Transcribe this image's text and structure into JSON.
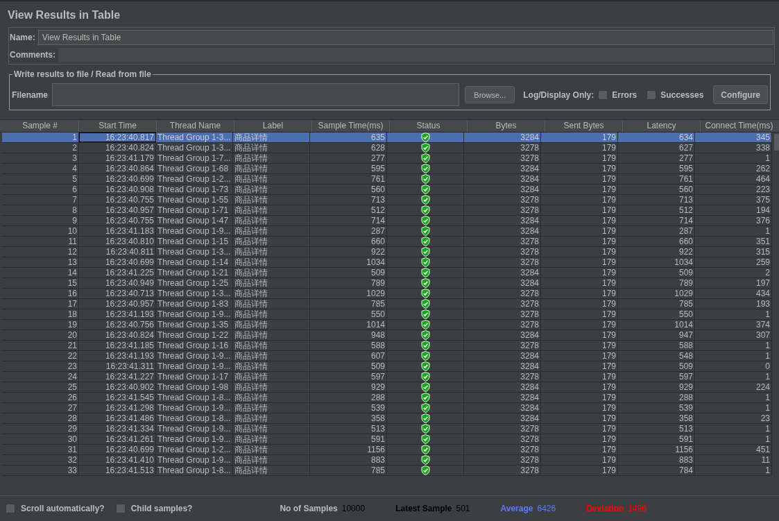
{
  "title": "View Results in Table",
  "name_field": {
    "label": "Name:",
    "value": "View Results in Table"
  },
  "comments_field": {
    "label": "Comments:"
  },
  "file_panel": {
    "legend": "Write results to file / Read from file",
    "filename_label": "Filename",
    "browse_button": "Browse...",
    "log_label": "Log/Display Only:",
    "checkboxes": [
      {
        "label": "Errors",
        "checked": false
      },
      {
        "label": "Successes",
        "checked": false
      }
    ],
    "configure_button": "Configure"
  },
  "table": {
    "columns": [
      "Sample #",
      "Start Time",
      "Thread Name",
      "Label",
      "Sample Time(ms)",
      "Status",
      "Bytes",
      "Sent Bytes",
      "Latency",
      "Connect Time(ms)"
    ],
    "rows": [
      {
        "n": "1",
        "start": "16:23:40.817",
        "thread": "Thread Group 1-3...",
        "label": "商品详情",
        "time": "635",
        "success": true,
        "bytes": "3284",
        "sent": "179",
        "latency": "634",
        "connect": "345",
        "selected": true
      },
      {
        "n": "2",
        "start": "16:23:40.824",
        "thread": "Thread Group 1-3...",
        "label": "商品详情",
        "time": "628",
        "success": true,
        "bytes": "3278",
        "sent": "179",
        "latency": "627",
        "connect": "338",
        "selected": false
      },
      {
        "n": "3",
        "start": "16:23:41.179",
        "thread": "Thread Group 1-7...",
        "label": "商品详情",
        "time": "277",
        "success": true,
        "bytes": "3278",
        "sent": "179",
        "latency": "277",
        "connect": "1",
        "selected": false
      },
      {
        "n": "4",
        "start": "16:23:40.864",
        "thread": "Thread Group 1-68",
        "label": "商品详情",
        "time": "595",
        "success": true,
        "bytes": "3284",
        "sent": "179",
        "latency": "595",
        "connect": "262",
        "selected": false
      },
      {
        "n": "5",
        "start": "16:23:40.699",
        "thread": "Thread Group 1-2...",
        "label": "商品详情",
        "time": "761",
        "success": true,
        "bytes": "3284",
        "sent": "179",
        "latency": "761",
        "connect": "464",
        "selected": false
      },
      {
        "n": "6",
        "start": "16:23:40.908",
        "thread": "Thread Group 1-73",
        "label": "商品详情",
        "time": "560",
        "success": true,
        "bytes": "3284",
        "sent": "179",
        "latency": "560",
        "connect": "223",
        "selected": false
      },
      {
        "n": "7",
        "start": "16:23:40.755",
        "thread": "Thread Group 1-55",
        "label": "商品详情",
        "time": "713",
        "success": true,
        "bytes": "3278",
        "sent": "179",
        "latency": "713",
        "connect": "375",
        "selected": false
      },
      {
        "n": "8",
        "start": "16:23:40.957",
        "thread": "Thread Group 1-71",
        "label": "商品详情",
        "time": "512",
        "success": true,
        "bytes": "3278",
        "sent": "179",
        "latency": "512",
        "connect": "194",
        "selected": false
      },
      {
        "n": "9",
        "start": "16:23:40.755",
        "thread": "Thread Group 1-47",
        "label": "商品详情",
        "time": "714",
        "success": true,
        "bytes": "3284",
        "sent": "179",
        "latency": "714",
        "connect": "376",
        "selected": false
      },
      {
        "n": "10",
        "start": "16:23:41.183",
        "thread": "Thread Group 1-9...",
        "label": "商品详情",
        "time": "287",
        "success": true,
        "bytes": "3284",
        "sent": "179",
        "latency": "287",
        "connect": "1",
        "selected": false
      },
      {
        "n": "11",
        "start": "16:23:40.810",
        "thread": "Thread Group 1-15",
        "label": "商品详情",
        "time": "660",
        "success": true,
        "bytes": "3278",
        "sent": "179",
        "latency": "660",
        "connect": "351",
        "selected": false
      },
      {
        "n": "12",
        "start": "16:23:40.811",
        "thread": "Thread Group 1-3...",
        "label": "商品详情",
        "time": "922",
        "success": true,
        "bytes": "3278",
        "sent": "179",
        "latency": "922",
        "connect": "315",
        "selected": false
      },
      {
        "n": "13",
        "start": "16:23:40.699",
        "thread": "Thread Group 1-14",
        "label": "商品详情",
        "time": "1034",
        "success": true,
        "bytes": "3278",
        "sent": "179",
        "latency": "1034",
        "connect": "259",
        "selected": false
      },
      {
        "n": "14",
        "start": "16:23:41.225",
        "thread": "Thread Group 1-21",
        "label": "商品详情",
        "time": "509",
        "success": true,
        "bytes": "3284",
        "sent": "179",
        "latency": "509",
        "connect": "2",
        "selected": false
      },
      {
        "n": "15",
        "start": "16:23:40.949",
        "thread": "Thread Group 1-25",
        "label": "商品详情",
        "time": "789",
        "success": true,
        "bytes": "3284",
        "sent": "179",
        "latency": "789",
        "connect": "197",
        "selected": false
      },
      {
        "n": "16",
        "start": "16:23:40.713",
        "thread": "Thread Group 1-3...",
        "label": "商品详情",
        "time": "1029",
        "success": true,
        "bytes": "3278",
        "sent": "179",
        "latency": "1029",
        "connect": "434",
        "selected": false
      },
      {
        "n": "17",
        "start": "16:23:40.957",
        "thread": "Thread Group 1-83",
        "label": "商品详情",
        "time": "785",
        "success": true,
        "bytes": "3278",
        "sent": "179",
        "latency": "785",
        "connect": "193",
        "selected": false
      },
      {
        "n": "18",
        "start": "16:23:41.193",
        "thread": "Thread Group 1-9...",
        "label": "商品详情",
        "time": "550",
        "success": true,
        "bytes": "3278",
        "sent": "179",
        "latency": "550",
        "connect": "1",
        "selected": false
      },
      {
        "n": "19",
        "start": "16:23:40.756",
        "thread": "Thread Group 1-35",
        "label": "商品详情",
        "time": "1014",
        "success": true,
        "bytes": "3278",
        "sent": "179",
        "latency": "1014",
        "connect": "374",
        "selected": false
      },
      {
        "n": "20",
        "start": "16:23:40.824",
        "thread": "Thread Group 1-22",
        "label": "商品详情",
        "time": "948",
        "success": true,
        "bytes": "3284",
        "sent": "179",
        "latency": "947",
        "connect": "307",
        "selected": false
      },
      {
        "n": "21",
        "start": "16:23:41.185",
        "thread": "Thread Group 1-16",
        "label": "商品详情",
        "time": "588",
        "success": true,
        "bytes": "3278",
        "sent": "179",
        "latency": "588",
        "connect": "1",
        "selected": false
      },
      {
        "n": "22",
        "start": "16:23:41.193",
        "thread": "Thread Group 1-9...",
        "label": "商品详情",
        "time": "607",
        "success": true,
        "bytes": "3284",
        "sent": "179",
        "latency": "548",
        "connect": "1",
        "selected": false
      },
      {
        "n": "23",
        "start": "16:23:41.311",
        "thread": "Thread Group 1-9...",
        "label": "商品详情",
        "time": "509",
        "success": true,
        "bytes": "3284",
        "sent": "179",
        "latency": "509",
        "connect": "0",
        "selected": false
      },
      {
        "n": "24",
        "start": "16:23:41.227",
        "thread": "Thread Group 1-17",
        "label": "商品详情",
        "time": "597",
        "success": true,
        "bytes": "3278",
        "sent": "179",
        "latency": "597",
        "connect": "1",
        "selected": false
      },
      {
        "n": "25",
        "start": "16:23:40.902",
        "thread": "Thread Group 1-98",
        "label": "商品详情",
        "time": "929",
        "success": true,
        "bytes": "3284",
        "sent": "179",
        "latency": "929",
        "connect": "224",
        "selected": false
      },
      {
        "n": "26",
        "start": "16:23:41.545",
        "thread": "Thread Group 1-8...",
        "label": "商品详情",
        "time": "288",
        "success": true,
        "bytes": "3284",
        "sent": "179",
        "latency": "288",
        "connect": "1",
        "selected": false
      },
      {
        "n": "27",
        "start": "16:23:41.298",
        "thread": "Thread Group 1-9...",
        "label": "商品详情",
        "time": "539",
        "success": true,
        "bytes": "3284",
        "sent": "179",
        "latency": "539",
        "connect": "1",
        "selected": false
      },
      {
        "n": "28",
        "start": "16:23:41.486",
        "thread": "Thread Group 1-8...",
        "label": "商品详情",
        "time": "358",
        "success": true,
        "bytes": "3284",
        "sent": "179",
        "latency": "358",
        "connect": "23",
        "selected": false
      },
      {
        "n": "29",
        "start": "16:23:41.334",
        "thread": "Thread Group 1-9...",
        "label": "商品详情",
        "time": "513",
        "success": true,
        "bytes": "3278",
        "sent": "179",
        "latency": "513",
        "connect": "1",
        "selected": false
      },
      {
        "n": "30",
        "start": "16:23:41.261",
        "thread": "Thread Group 1-9...",
        "label": "商品详情",
        "time": "591",
        "success": true,
        "bytes": "3278",
        "sent": "179",
        "latency": "591",
        "connect": "1",
        "selected": false
      },
      {
        "n": "31",
        "start": "16:23:40.699",
        "thread": "Thread Group 1-2...",
        "label": "商品详情",
        "time": "1156",
        "success": true,
        "bytes": "3278",
        "sent": "179",
        "latency": "1156",
        "connect": "451",
        "selected": false
      },
      {
        "n": "32",
        "start": "16:23:41.410",
        "thread": "Thread Group 1-9...",
        "label": "商品详情",
        "time": "883",
        "success": true,
        "bytes": "3278",
        "sent": "179",
        "latency": "883",
        "connect": "11",
        "selected": false
      },
      {
        "n": "33",
        "start": "16:23:41.513",
        "thread": "Thread Group 1-8...",
        "label": "商品详情",
        "time": "785",
        "success": true,
        "bytes": "3278",
        "sent": "179",
        "latency": "784",
        "connect": "1",
        "selected": false
      }
    ]
  },
  "bottom_checkboxes": [
    {
      "label": "Scroll automatically?",
      "checked": false
    },
    {
      "label": "Child samples?",
      "checked": false
    }
  ],
  "stats": [
    {
      "label": "No of Samples",
      "value": "10000",
      "color": "#000000"
    },
    {
      "label": "Latest Sample",
      "value": "501",
      "color": "#000000"
    },
    {
      "label": "Average",
      "value": "6426",
      "color": "#5c7cff"
    },
    {
      "label": "Deviation",
      "value": "1496",
      "color": "#ff0000"
    }
  ]
}
